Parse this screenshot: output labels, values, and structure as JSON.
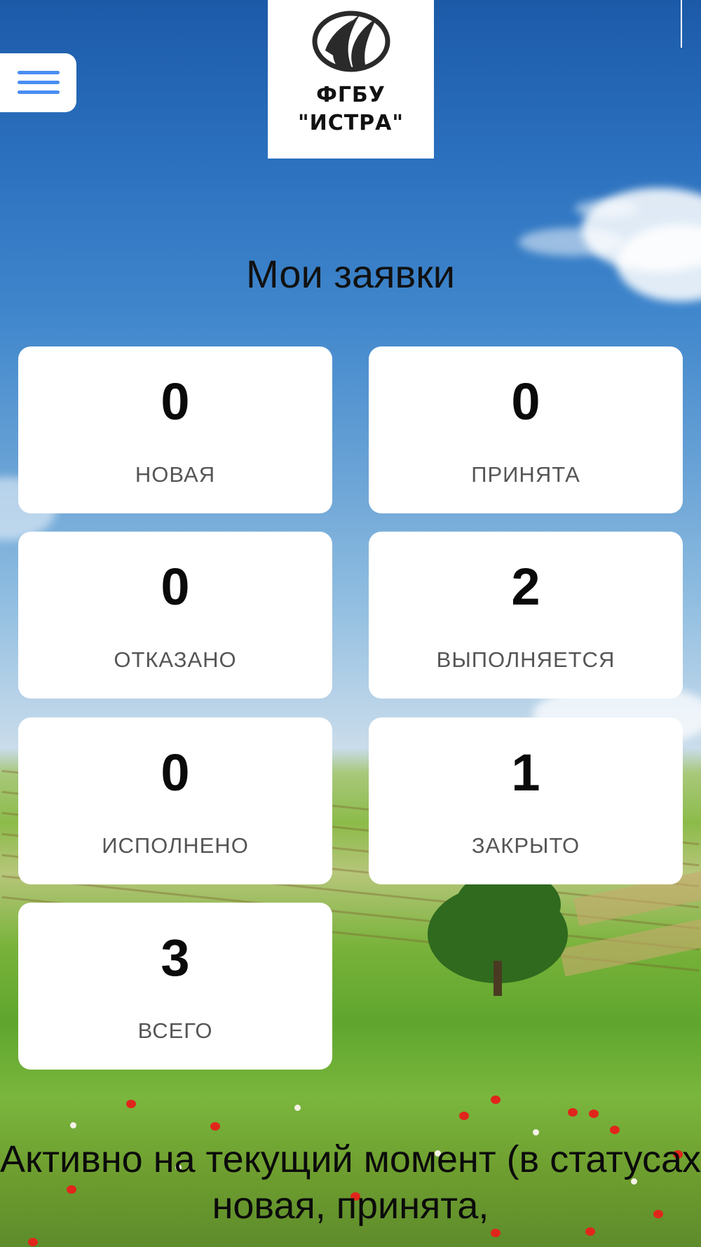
{
  "header": {
    "menu_icon": "hamburger-menu-icon",
    "logo": {
      "mark_icon": "flame-leaf-logo-icon",
      "line1": "ФГБУ",
      "line2": "\"ИСТРА\""
    }
  },
  "page": {
    "title": "Мои заявки"
  },
  "stats": [
    {
      "count": "0",
      "label": "НОВАЯ"
    },
    {
      "count": "0",
      "label": "ПРИНЯТА"
    },
    {
      "count": "0",
      "label": "ОТКАЗАНО"
    },
    {
      "count": "2",
      "label": "ВЫПОЛНЯЕТСЯ"
    },
    {
      "count": "0",
      "label": "ИСПОЛНЕНО"
    },
    {
      "count": "1",
      "label": "ЗАКРЫТО"
    },
    {
      "count": "3",
      "label": "ВСЕГО"
    }
  ],
  "footer": {
    "active_text": "Активно на текущий момент (в статусах новая, принята,"
  },
  "colors": {
    "accent": "#4a8df2",
    "card_bg": "#ffffff",
    "label_text": "#555555"
  }
}
